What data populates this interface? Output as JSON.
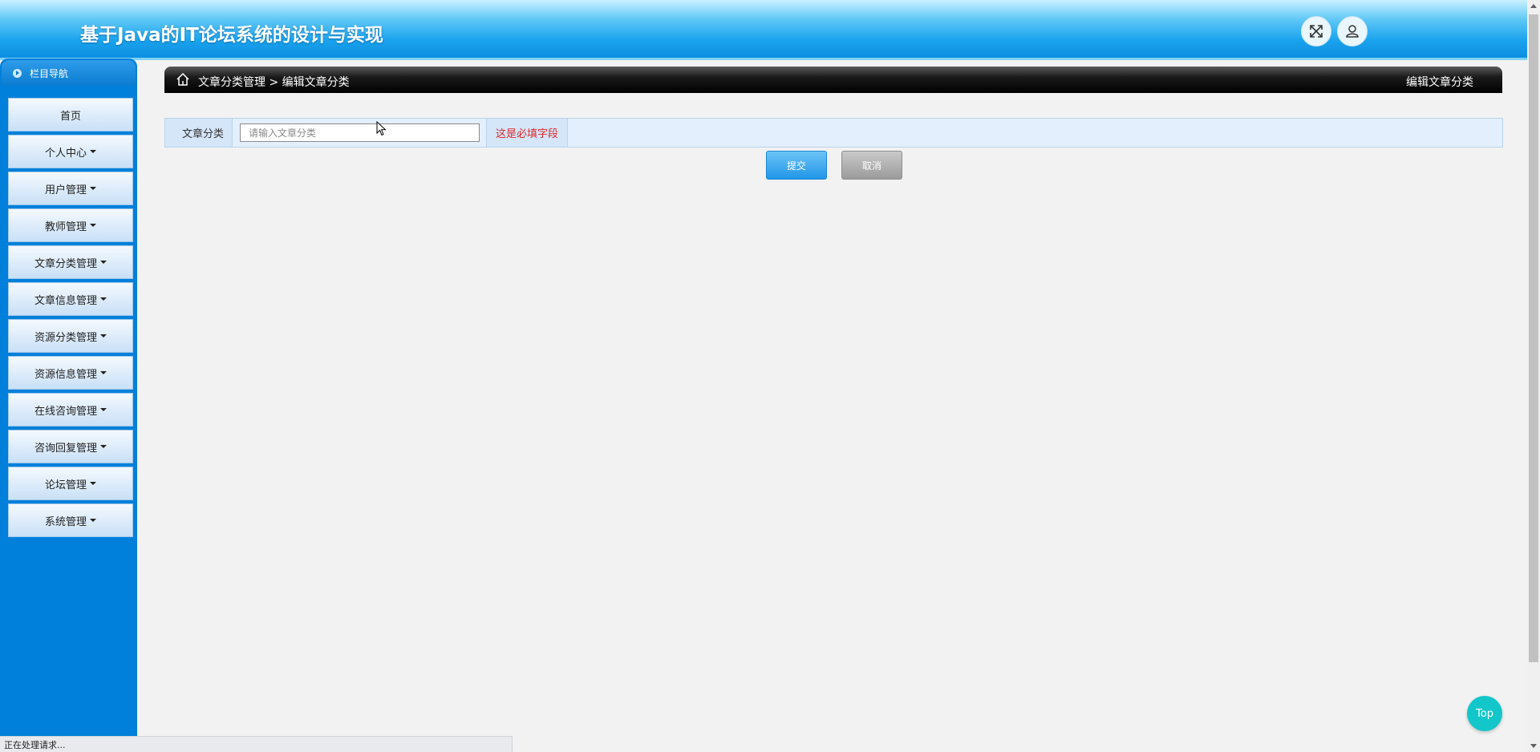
{
  "app": {
    "title": "基于Java的IT论坛系统的设计与实现",
    "header_icons": [
      "fullscreen-icon",
      "user-icon"
    ]
  },
  "sidebar": {
    "title": "栏目导航",
    "items": [
      {
        "label": "首页",
        "has_dropdown": false
      },
      {
        "label": "个人中心",
        "has_dropdown": true
      },
      {
        "label": "用户管理",
        "has_dropdown": true
      },
      {
        "label": "教师管理",
        "has_dropdown": true
      },
      {
        "label": "文章分类管理",
        "has_dropdown": true
      },
      {
        "label": "文章信息管理",
        "has_dropdown": true
      },
      {
        "label": "资源分类管理",
        "has_dropdown": true
      },
      {
        "label": "资源信息管理",
        "has_dropdown": true
      },
      {
        "label": "在线咨询管理",
        "has_dropdown": true
      },
      {
        "label": "咨询回复管理",
        "has_dropdown": true
      },
      {
        "label": "论坛管理",
        "has_dropdown": true
      },
      {
        "label": "系统管理",
        "has_dropdown": true
      }
    ]
  },
  "breadcrumb": {
    "path": "文章分类管理 > 编辑文章分类",
    "page_title": "编辑文章分类"
  },
  "form": {
    "field_label": "文章分类",
    "field_value": "",
    "field_placeholder": "请输入文章分类",
    "required_hint": "这是必填字段",
    "submit_label": "提交",
    "cancel_label": "取消"
  },
  "top_button": "Top",
  "status_bar": "正在处理请求...",
  "colors": {
    "header_blue": "#1aa3ee",
    "sidebar_blue": "#0080da",
    "required_red": "#e0262a",
    "top_button_teal": "#12c6c9"
  }
}
